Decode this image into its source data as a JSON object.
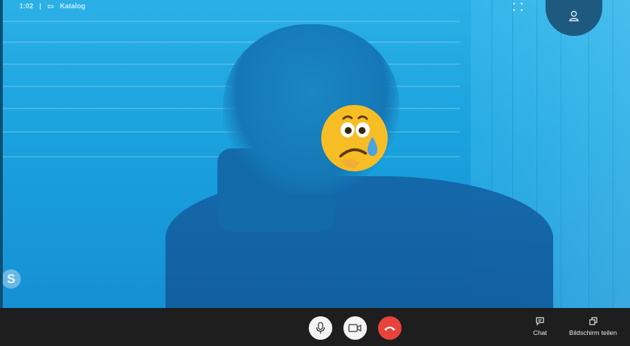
{
  "topbar": {
    "time": "1:02",
    "separator": "|",
    "catalog_label": "Katalog"
  },
  "call_controls": {
    "mute_icon": "microphone-icon",
    "video_icon": "video-camera-icon",
    "hangup_icon": "phone-hangup-icon"
  },
  "side_actions": {
    "chat_label": "Chat",
    "share_label": "Bildschirm teilen"
  },
  "reaction": {
    "icon": "sad-tear-emoji"
  },
  "colors": {
    "hangup": "#e8423c",
    "video_tint": "#1aa2de",
    "toolbar": "#1e1e1e"
  }
}
